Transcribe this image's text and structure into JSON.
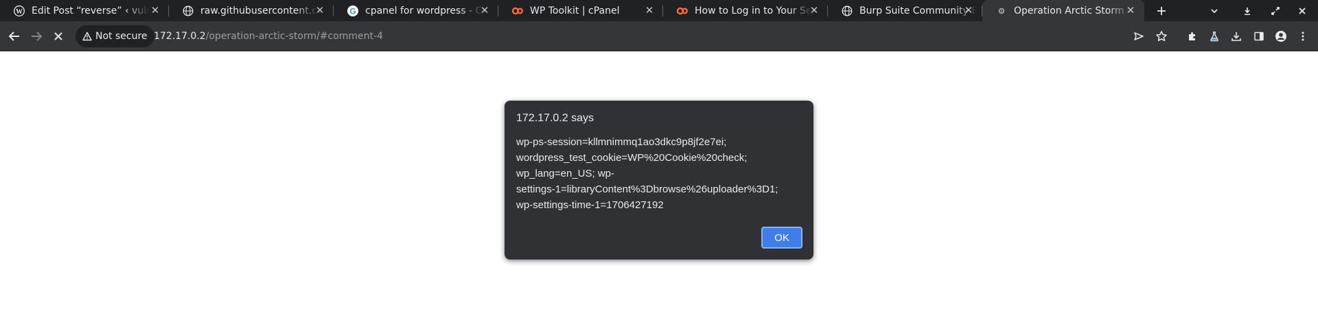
{
  "tabs": [
    {
      "title": "Edit Post “reverse” ‹ vulnp",
      "icon": "wordpress-icon"
    },
    {
      "title": "raw.githubusercontent.com",
      "icon": "globe-icon"
    },
    {
      "title": "cpanel for wordpress - Goo",
      "icon": "google-icon"
    },
    {
      "title": "WP Toolkit | cPanel",
      "icon": "cpanel-icon"
    },
    {
      "title": "How to Log in to Your Serv",
      "icon": "cpanel-icon"
    },
    {
      "title": "Burp Suite Community Editi",
      "icon": "globe-icon"
    },
    {
      "title": "Operation Arctic Storm – ",
      "icon": "site-icon"
    }
  ],
  "tab_close_glyph": "✕",
  "toolbar": {
    "security_label": "Not secure",
    "url_host": "172.17.0.2",
    "url_path": "/operation-arctic-storm/#comment-4"
  },
  "dialog": {
    "title": "172.17.0.2 says",
    "message": "wp-ps-session=kllmnimmq1ao3dkc9p8jf2e7ei;\nwordpress_test_cookie=WP%20Cookie%20check;\nwp_lang=en_US; wp-\nsettings-1=libraryContent%3Dbrowse%26uploader%3D1;\nwp-settings-time-1=1706427192",
    "ok_label": "OK"
  },
  "colors": {
    "tabstrip": "#202124",
    "toolbar": "#35363a",
    "dialog": "#303134",
    "ok_button": "#3f7ee8",
    "cpanel_orange": "#ff6c2c"
  }
}
